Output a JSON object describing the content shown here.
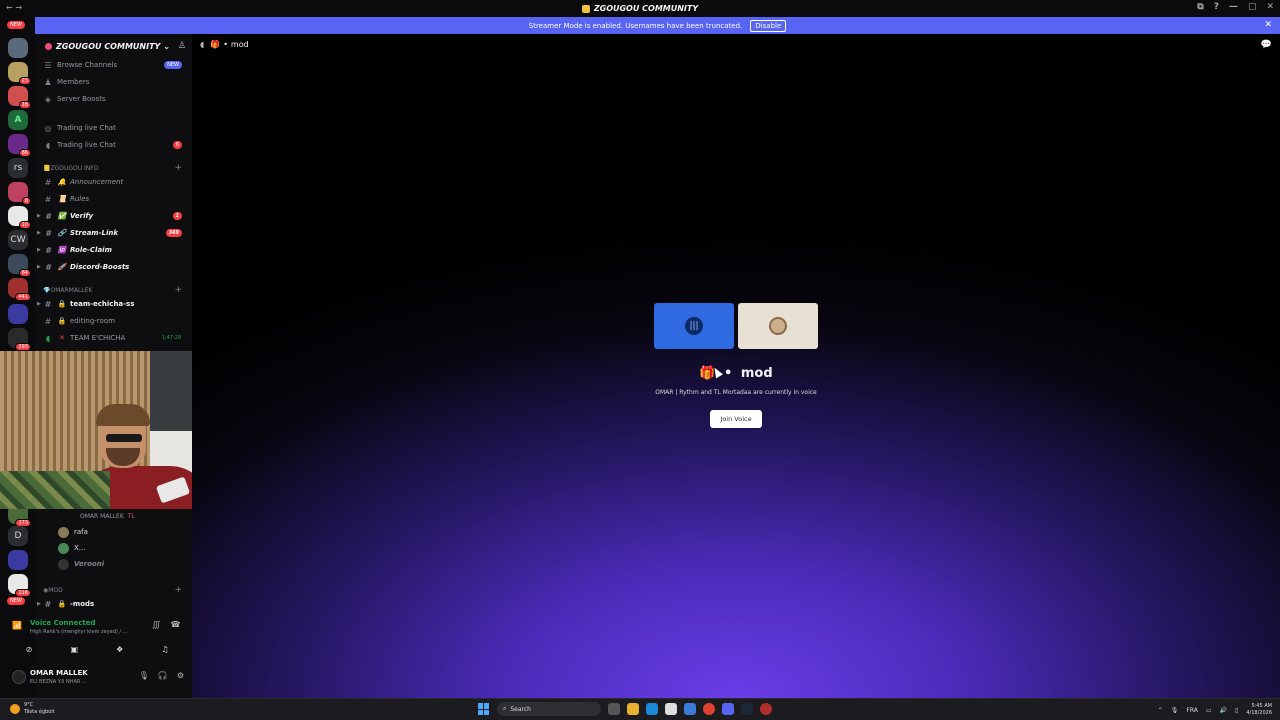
{
  "window": {
    "title": "ZGOUGOU COMMUNITY",
    "controls": [
      "⧉",
      "?",
      "—",
      "▢",
      "✕"
    ]
  },
  "banner": {
    "message": "Streamer Mode is enabled. Usernames have been truncated.",
    "disable_label": "Disable"
  },
  "guild_rail": {
    "new_label": "NEW",
    "new_label_bottom": "NEW",
    "letters": {
      "a": "A",
      "rs": "rs",
      "cw": "CW",
      "d": "D"
    },
    "badges": {
      "b1": "23",
      "b2": "18",
      "b3": "86",
      "b4": "8",
      "b5": "10",
      "b6": "64",
      "b7": "441",
      "b8": "293",
      "b9": "273",
      "b10": "116"
    }
  },
  "sidebar": {
    "server_name": "ZGOUGOU COMMUNITY",
    "browse_channels": "Browse Channels",
    "browse_badge": "NEW",
    "members": "Members",
    "server_boosts": "Server Boosts",
    "trading_1": "Trading live Chat",
    "trading_2": "Trading live Chat",
    "trading_2_badge": "6",
    "cat_info": "ZGOUGOU INFO",
    "ch_announcement": "Announcement",
    "ch_rules": "Rules",
    "ch_verify": "Verify",
    "ch_verify_badge": "1",
    "ch_stream_link": "Stream-Link",
    "ch_stream_link_badge": "349",
    "ch_role_claim": "Role-Claim",
    "ch_discord_boosts": "Discord-Boosts",
    "cat_omar": "OMARMALLEK",
    "ch_team_echicha_ss": "team-echicha-ss",
    "ch_editing_room": "editing-room",
    "ch_team_echicha_voice": "TEAM E'CHICHA",
    "voice_timer": "1:47:28",
    "voice_owner": "OMAR MALLEK",
    "voice_owner_tag": "TL",
    "voice_users": [
      "rafa",
      "X...",
      "Verooni"
    ],
    "cat_mod": "Mod",
    "ch_mods": "-mods"
  },
  "voice_connection": {
    "status": "Voice Connected",
    "channel": "High Rank's (menghyr klem zeyed) / ..."
  },
  "user_panel": {
    "name": "OMAR MALLEK",
    "status": "ELI BEZNA Y.II NHAR ..."
  },
  "main": {
    "channel_name": "mod",
    "voice_title": "mod",
    "voice_subtitle": "OMAR | Rythm and TL Mortadaa are currently in voice",
    "join_label": "Join Voice"
  },
  "taskbar": {
    "temperature": "9°C",
    "weather": "Tâsta égboit",
    "search_placeholder": "Search",
    "language": "FRA",
    "time": "5:45 AM",
    "date": "4/18/2026"
  },
  "colors": {
    "accent": "#5865f2",
    "danger": "#f23f43",
    "success": "#23a559"
  }
}
